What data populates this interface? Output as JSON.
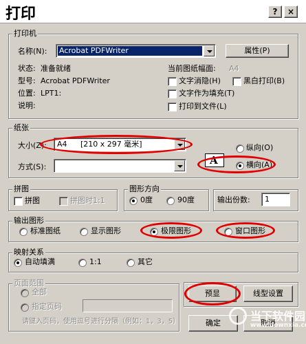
{
  "window": {
    "title": "打印",
    "help": "?",
    "close": "×"
  },
  "printer": {
    "legend": "打印机",
    "name_label": "名称(N):",
    "name_value": "Acrobat PDFWriter",
    "properties_button": "属性(P)",
    "status_label": "状态:",
    "status_value": "准备就绪",
    "type_label": "型号:",
    "type_value": "Acrobat PDFWriter",
    "location_label": "位置:",
    "location_value": "LPT1:",
    "comment_label": "说明:",
    "current_paper_label": "当前图纸幅面:",
    "current_paper_value": "A4",
    "text_hide": "文字消隐(H)",
    "text_as_fill": "文字作为填充(T)",
    "print_to_file": "打印到文件(L)",
    "monochrome": "黑白打印(B)"
  },
  "paper": {
    "legend": "纸张",
    "size_label": "大小(Z):",
    "size_value": "A4",
    "size_dims": "[210 x 297 毫米]",
    "method_label": "方式(S):",
    "method_value": "",
    "orientation_glyph": "A",
    "portrait": "纵向(O)",
    "landscape": "横向(A)"
  },
  "tiling": {
    "legend": "拼图",
    "tile": "拼图",
    "tile_at_1_1": "拼图时1:1"
  },
  "rotation": {
    "legend": "图形方向",
    "deg0": "0度",
    "deg90": "90度"
  },
  "copies": {
    "label": "输出份数:",
    "value": "1"
  },
  "output": {
    "legend": "输出图形",
    "standard": "标准图纸",
    "display": "显示图形",
    "extents": "极限图形",
    "window": "窗口图形"
  },
  "mapping": {
    "legend": "映射关系",
    "auto": "自动填满",
    "one_to_one": "1:1",
    "other": "其它"
  },
  "page_range": {
    "legend": "页面范围",
    "all": "全部",
    "specify": "指定页码",
    "hint": "请键入页码，使用逗号进行分隔（例如：1，3，5）"
  },
  "buttons": {
    "preview": "预显",
    "linetype": "线型设置",
    "ok": "确定",
    "cancel": "取消"
  },
  "watermark": {
    "text": "当下软件园",
    "url": "www.downxia.com"
  },
  "colors": {
    "highlight": "#e00000",
    "selection": "#0a246a",
    "face": "#d4d0c8"
  }
}
